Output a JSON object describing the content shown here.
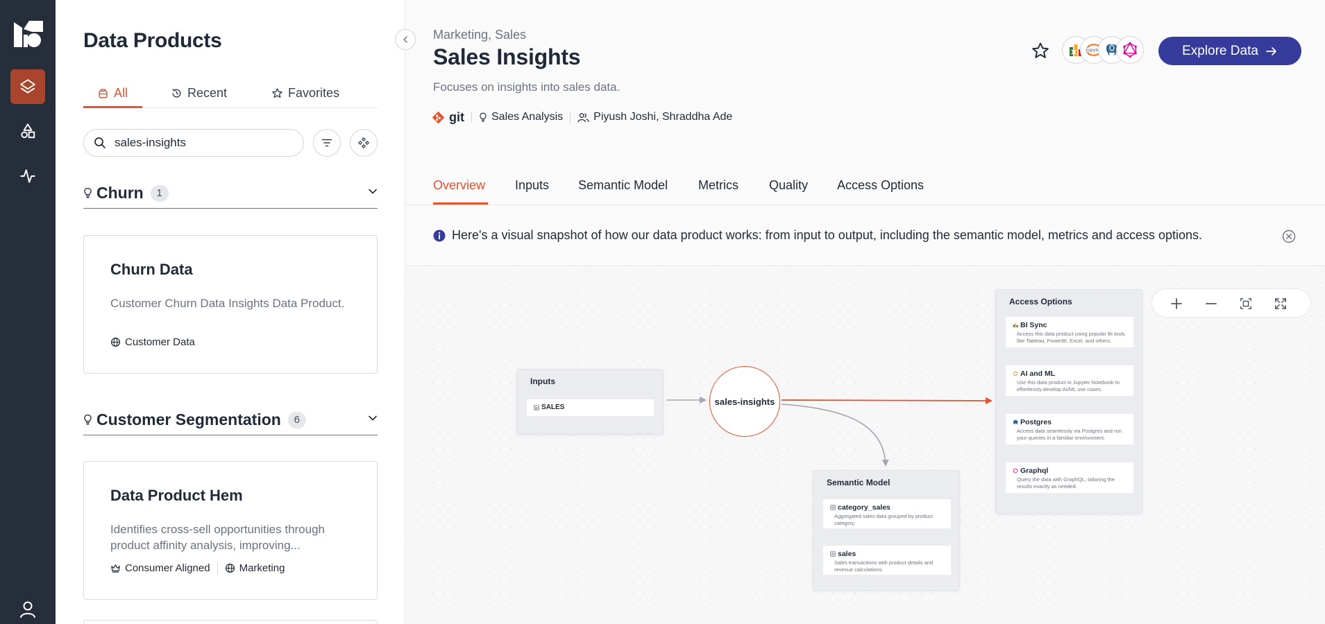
{
  "sidebar": {
    "title": "Data Products",
    "tabs": [
      {
        "label": "All",
        "icon": "box-icon"
      },
      {
        "label": "Recent",
        "icon": "history-icon"
      },
      {
        "label": "Favorites",
        "icon": "star-icon"
      }
    ],
    "search": {
      "value": "sales-insights"
    },
    "groups": [
      {
        "name": "Churn",
        "count": "1",
        "cards": [
          {
            "title": "Churn Data",
            "description": "Customer Churn Data Insights Data Product.",
            "tags": [
              "Customer Data"
            ]
          }
        ]
      },
      {
        "name": "Customer Segmentation",
        "count": "6",
        "cards": [
          {
            "title": "Data Product Hem",
            "description": "Identifies cross-sell opportunities through product affinity analysis, improving...",
            "tags": [
              "Consumer Aligned",
              "Marketing"
            ]
          }
        ]
      }
    ]
  },
  "product": {
    "breadcrumb": "Marketing, Sales",
    "title": "Sales Insights",
    "description": "Focuses on insights into sales data.",
    "meta": {
      "git": "git",
      "use_case": "Sales Analysis",
      "owners": "Piyush Joshi, Shraddha Ade"
    },
    "explore_label": "Explore Data",
    "tool_icons": [
      "excel-icon",
      "jupyter-icon",
      "postgres-icon",
      "graphql-icon"
    ]
  },
  "tabs": [
    "Overview",
    "Inputs",
    "Semantic Model",
    "Metrics",
    "Quality",
    "Access Options"
  ],
  "info_banner": "Here's a visual snapshot of how our data product works: from input to output, including the semantic model, metrics and access options.",
  "diagram": {
    "inputs": {
      "title": "Inputs",
      "items": [
        "SALES"
      ]
    },
    "product_node": "sales-insights",
    "semantic_model": {
      "title": "Semantic Model",
      "items": [
        {
          "name": "category_sales",
          "desc": "Aggregated sales data grouped by product category."
        },
        {
          "name": "sales",
          "desc": "Sales transactions with product details and revenue calculations."
        }
      ]
    },
    "access_options": {
      "title": "Access Options",
      "items": [
        {
          "name": "BI Sync",
          "desc": "Access this data product using popular BI tools like Tableau, PowerBI, Excel, and others."
        },
        {
          "name": "AI and ML",
          "desc": "Use this data product in Jupyter Notebook to effortlessly develop AI/ML use cases."
        },
        {
          "name": "Postgres",
          "desc": "Access data seamlessly via Postgres and run your queries in a familiar environment."
        },
        {
          "name": "Graphql",
          "desc": "Query the data with GraphQL, tailoring the results exactly as needed."
        }
      ]
    }
  },
  "colors": {
    "accent": "#e2522c",
    "primary": "#343b9b",
    "rail": "#262d3b",
    "rail_active": "#a9452d"
  }
}
